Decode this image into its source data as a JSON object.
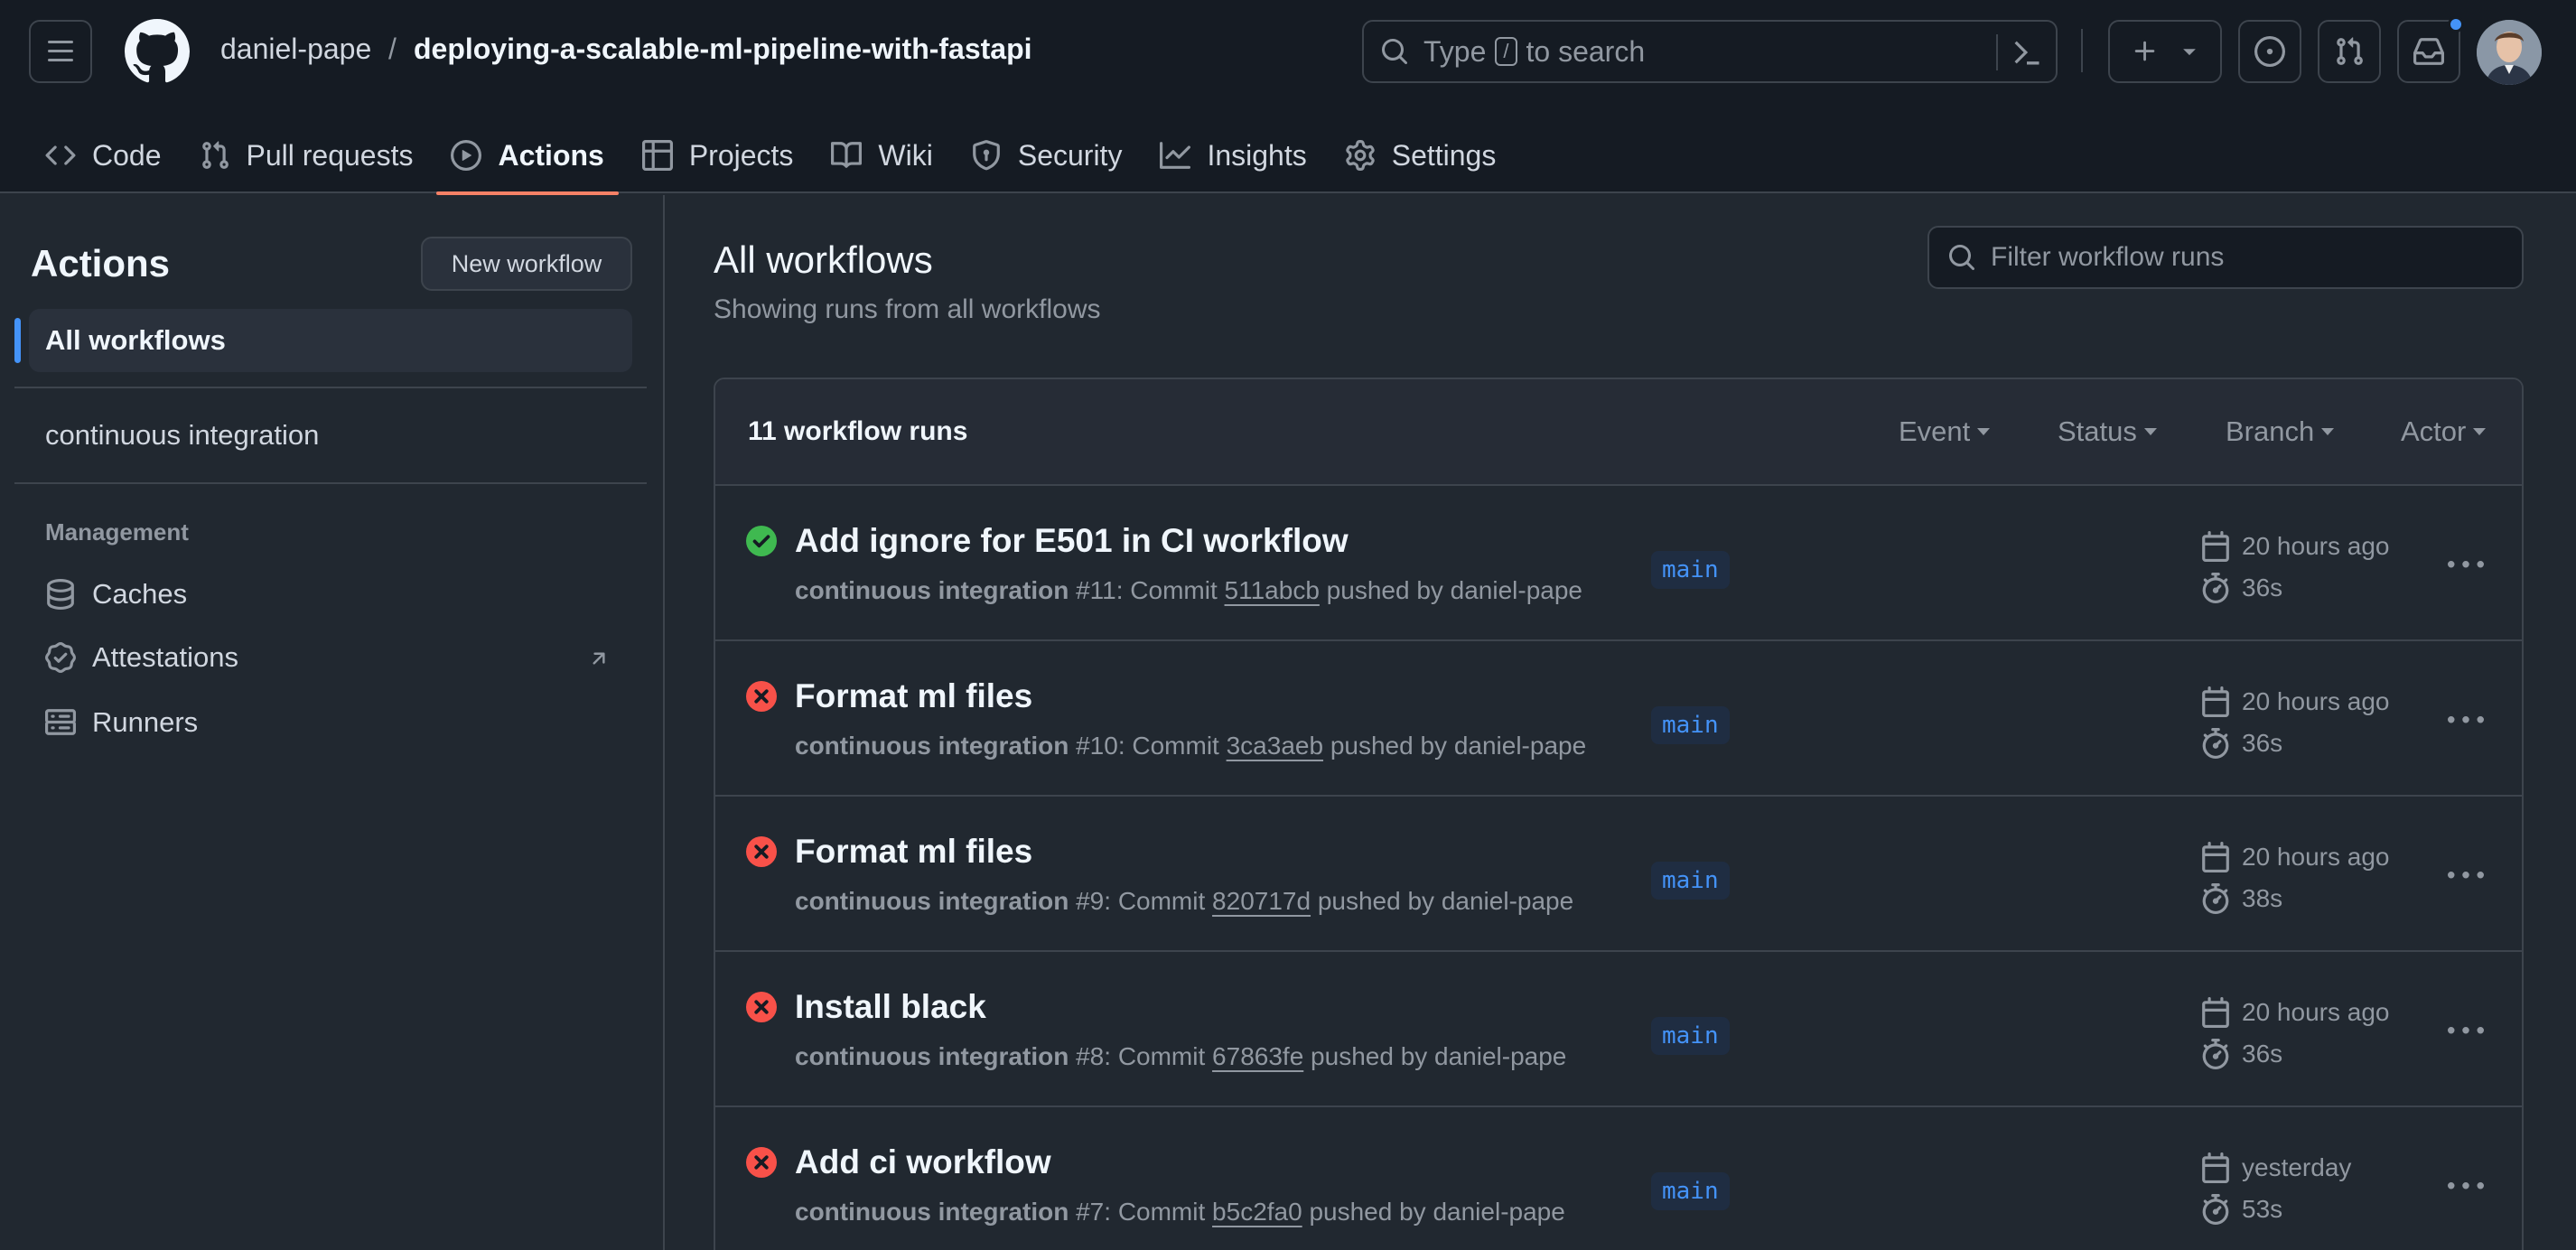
{
  "header": {
    "owner": "daniel-pape",
    "separator": "/",
    "repo": "deploying-a-scalable-ml-pipeline-with-fastapi",
    "search": {
      "prefix": "Type",
      "key": "/",
      "suffix": "to search"
    }
  },
  "tabs": [
    {
      "label": "Code",
      "icon": "code-icon"
    },
    {
      "label": "Pull requests",
      "icon": "git-pull-request-icon"
    },
    {
      "label": "Actions",
      "icon": "play-icon",
      "active": true
    },
    {
      "label": "Projects",
      "icon": "table-icon"
    },
    {
      "label": "Wiki",
      "icon": "book-icon"
    },
    {
      "label": "Security",
      "icon": "shield-icon"
    },
    {
      "label": "Insights",
      "icon": "graph-icon"
    },
    {
      "label": "Settings",
      "icon": "gear-icon"
    }
  ],
  "sidebar": {
    "title": "Actions",
    "new_workflow": "New workflow",
    "all_workflows": "All workflows",
    "workflows": [
      "continuous integration"
    ],
    "management_label": "Management",
    "management": [
      {
        "label": "Caches",
        "icon": "database-icon"
      },
      {
        "label": "Attestations",
        "icon": "verified-icon"
      },
      {
        "label": "Runners",
        "icon": "server-icon"
      }
    ]
  },
  "main": {
    "title": "All workflows",
    "subtitle": "Showing runs from all workflows",
    "filter_placeholder": "Filter workflow runs",
    "runs_count": "11 workflow runs",
    "filters": [
      "Event",
      "Status",
      "Branch",
      "Actor"
    ],
    "runs": [
      {
        "status": "success",
        "title": "Add ignore for E501 in CI workflow",
        "workflow": "continuous integration",
        "number": "#11",
        "commit_label": "Commit",
        "sha": "511abcb",
        "pushed_by": "pushed by daniel-pape",
        "branch": "main",
        "when": "20 hours ago",
        "duration": "36s"
      },
      {
        "status": "failure",
        "title": "Format ml files",
        "workflow": "continuous integration",
        "number": "#10",
        "commit_label": "Commit",
        "sha": "3ca3aeb",
        "pushed_by": "pushed by daniel-pape",
        "branch": "main",
        "when": "20 hours ago",
        "duration": "36s"
      },
      {
        "status": "failure",
        "title": "Format ml files",
        "workflow": "continuous integration",
        "number": "#9",
        "commit_label": "Commit",
        "sha": "820717d",
        "pushed_by": "pushed by daniel-pape",
        "branch": "main",
        "when": "20 hours ago",
        "duration": "38s"
      },
      {
        "status": "failure",
        "title": "Install black",
        "workflow": "continuous integration",
        "number": "#8",
        "commit_label": "Commit",
        "sha": "67863fe",
        "pushed_by": "pushed by daniel-pape",
        "branch": "main",
        "when": "20 hours ago",
        "duration": "36s"
      },
      {
        "status": "failure",
        "title": "Add ci workflow",
        "workflow": "continuous integration",
        "number": "#7",
        "commit_label": "Commit",
        "sha": "b5c2fa0",
        "pushed_by": "pushed by daniel-pape",
        "branch": "main",
        "when": "yesterday",
        "duration": "53s"
      }
    ]
  },
  "colors": {
    "success": "#3fb950",
    "failure": "#f85149",
    "accent": "#4493f8",
    "tab_underline": "#f78166"
  }
}
